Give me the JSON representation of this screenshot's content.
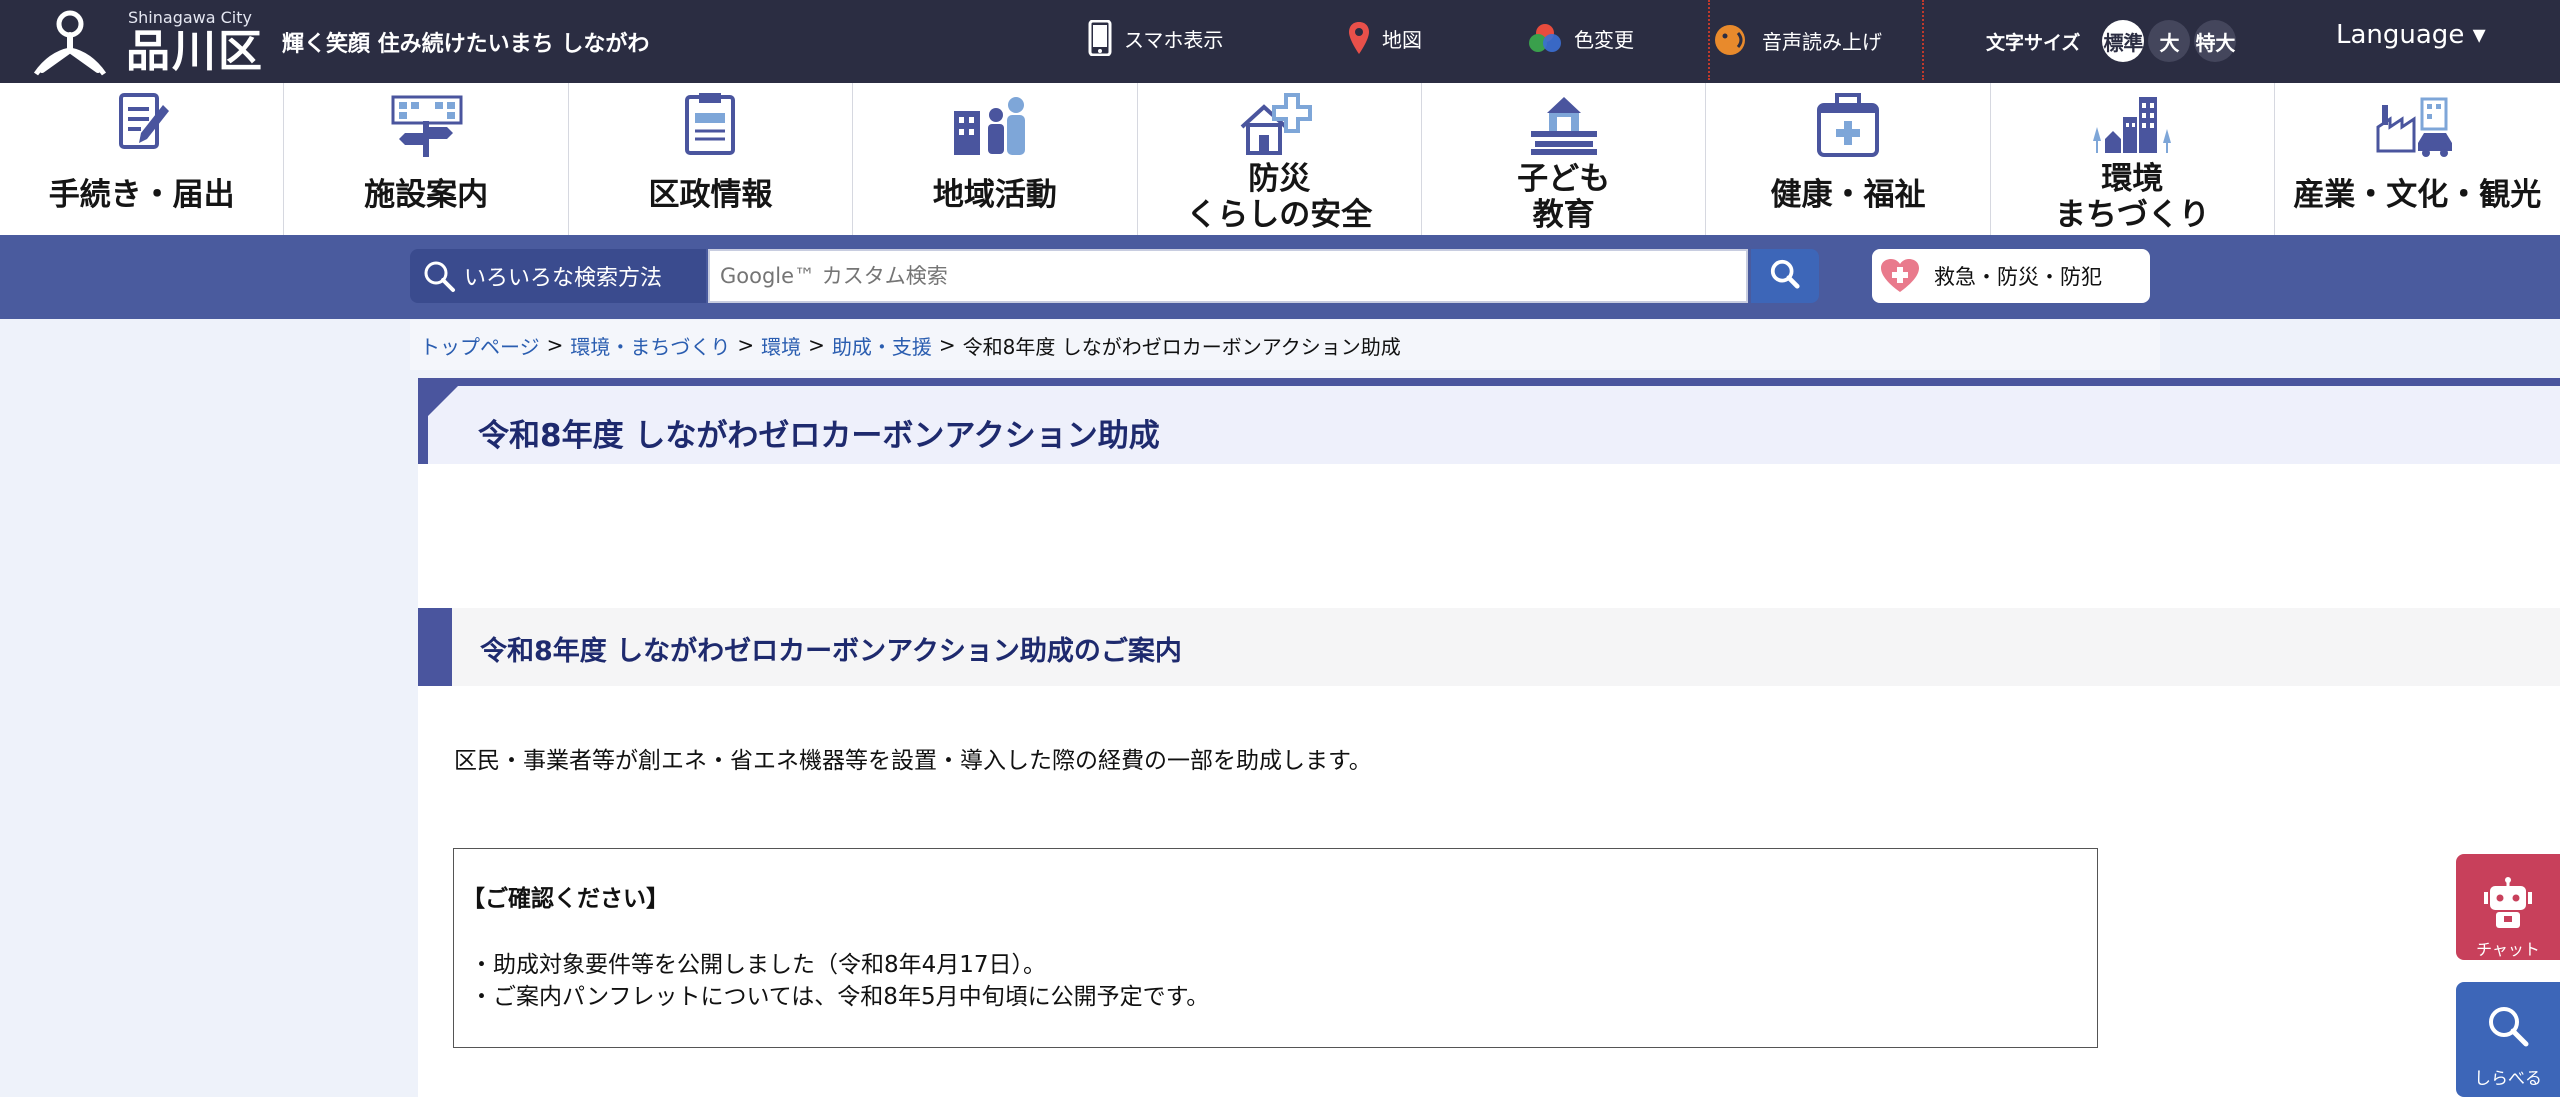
{
  "header": {
    "logo_en": "Shinagawa City",
    "logo_jp": "品川区",
    "tagline": "輝く笑顔 住み続けたいまち しながわ",
    "tools": {
      "smartphone": "スマホ表示",
      "map": "地図",
      "color": "色変更",
      "voice": "音声読み上げ"
    },
    "font_size": {
      "label": "文字サイズ",
      "standard": "標準",
      "large": "大",
      "xlarge": "特大"
    },
    "language": "Language ▾"
  },
  "categories": [
    {
      "label": "手続き・届出",
      "icon": "document-pen-icon"
    },
    {
      "label": "施設案内",
      "icon": "building-directions-icon"
    },
    {
      "label": "区政情報",
      "icon": "clipboard-icon"
    },
    {
      "label": "地域活動",
      "icon": "community-people-icon"
    },
    {
      "label": "防災",
      "label2": "くらしの安全",
      "icon": "house-cross-icon"
    },
    {
      "label": "子ども",
      "label2": "教育",
      "icon": "school-building-icon"
    },
    {
      "label": "健康・福祉",
      "icon": "medical-bag-icon"
    },
    {
      "label": "環境",
      "label2": "まちづくり",
      "icon": "city-trees-icon"
    },
    {
      "label": "産業・文化・観光",
      "icon": "factory-car-icon"
    }
  ],
  "search": {
    "methods_label": "いろいろな検索方法",
    "placeholder": "Google™ カスタム検索",
    "emergency_label": "救急・防災・防犯"
  },
  "breadcrumb": {
    "items": [
      "トップページ",
      "環境・まちづくり",
      "環境",
      "助成・支援"
    ],
    "current": "令和8年度 しながわゼロカーボンアクション助成",
    "separator": ">"
  },
  "main": {
    "title": "令和8年度 しながわゼロカーボンアクション助成",
    "section_heading": "令和8年度 しながわゼロカーボンアクション助成のご案内",
    "intro": "区民・事業者等が創エネ・省エネ機器等を設置・導入した際の経費の一部を助成します。",
    "notice": {
      "heading": "【ご確認ください】",
      "line1": "・助成対象要件等を公開しました（令和8年4月17日）。",
      "line2": "・ご案内パンフレットについては、令和8年5月中旬頃に公開予定です。"
    }
  },
  "floating": {
    "chat_label": "チャット",
    "search_label": "しらべる"
  },
  "colors": {
    "topbar": "#2b2d42",
    "accent": "#4a559e",
    "link": "#2a5db0",
    "chat": "#c8405b",
    "search": "#3d66b8"
  }
}
